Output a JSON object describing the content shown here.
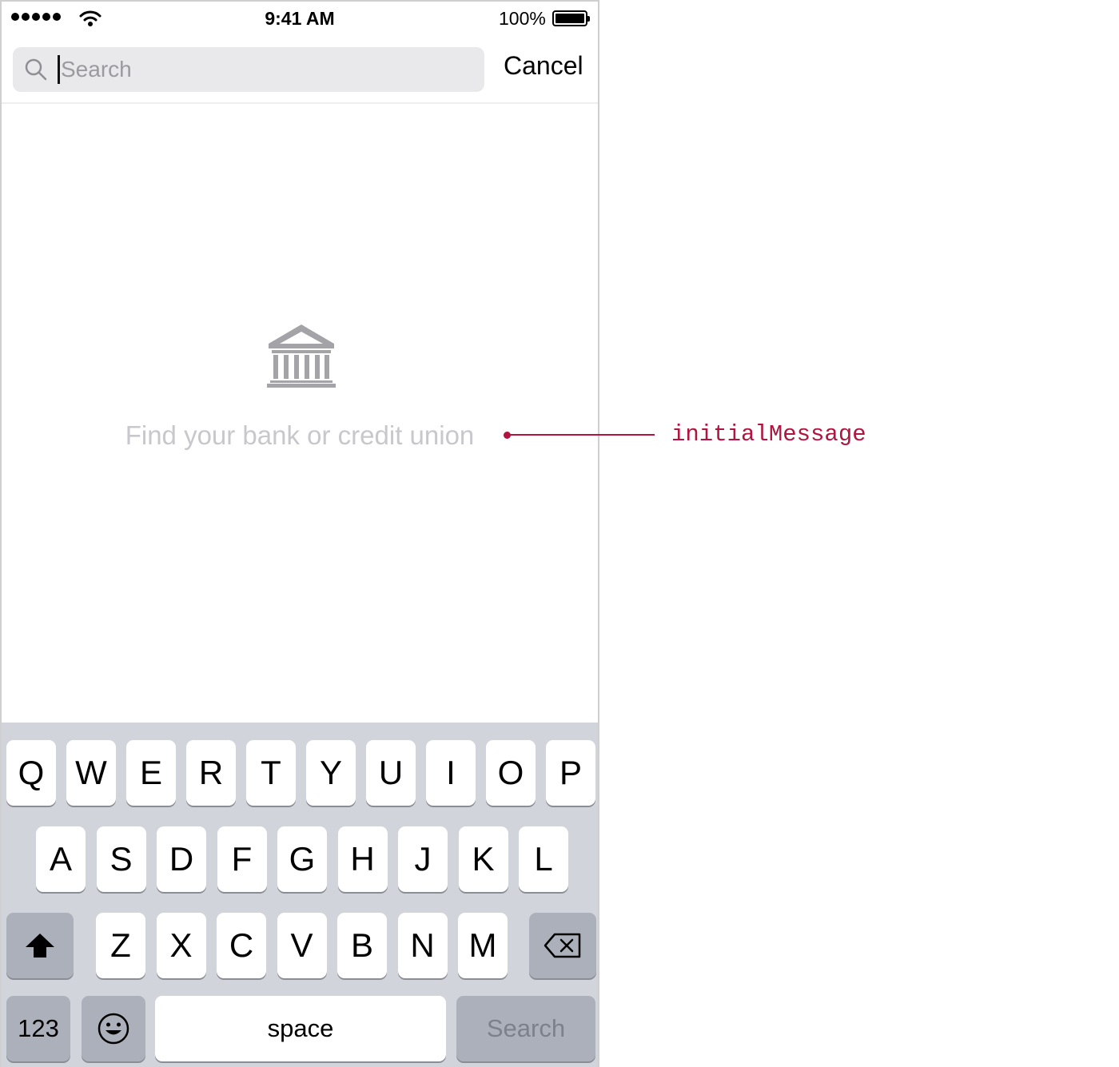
{
  "status_bar": {
    "time": "9:41 AM",
    "battery_percent": "100%",
    "signal_bars": 5,
    "icons": [
      "signal-dots-icon",
      "wifi-icon",
      "battery-icon"
    ]
  },
  "search": {
    "placeholder": "Search",
    "value": "",
    "cancel_label": "Cancel"
  },
  "empty_state": {
    "icon": "bank-icon",
    "message": "Find your bank or credit union"
  },
  "annotation": {
    "label": "initialMessage",
    "color": "#b0143f"
  },
  "keyboard": {
    "row1": [
      "Q",
      "W",
      "E",
      "R",
      "T",
      "Y",
      "U",
      "I",
      "O",
      "P"
    ],
    "row2": [
      "A",
      "S",
      "D",
      "F",
      "G",
      "H",
      "J",
      "K",
      "L"
    ],
    "row3": [
      "Z",
      "X",
      "C",
      "V",
      "B",
      "N",
      "M"
    ],
    "numbers_label": "123",
    "space_label": "space",
    "search_label": "Search",
    "shift_icon": "shift-icon",
    "delete_icon": "backspace-icon",
    "emoji_icon": "emoji-icon"
  }
}
